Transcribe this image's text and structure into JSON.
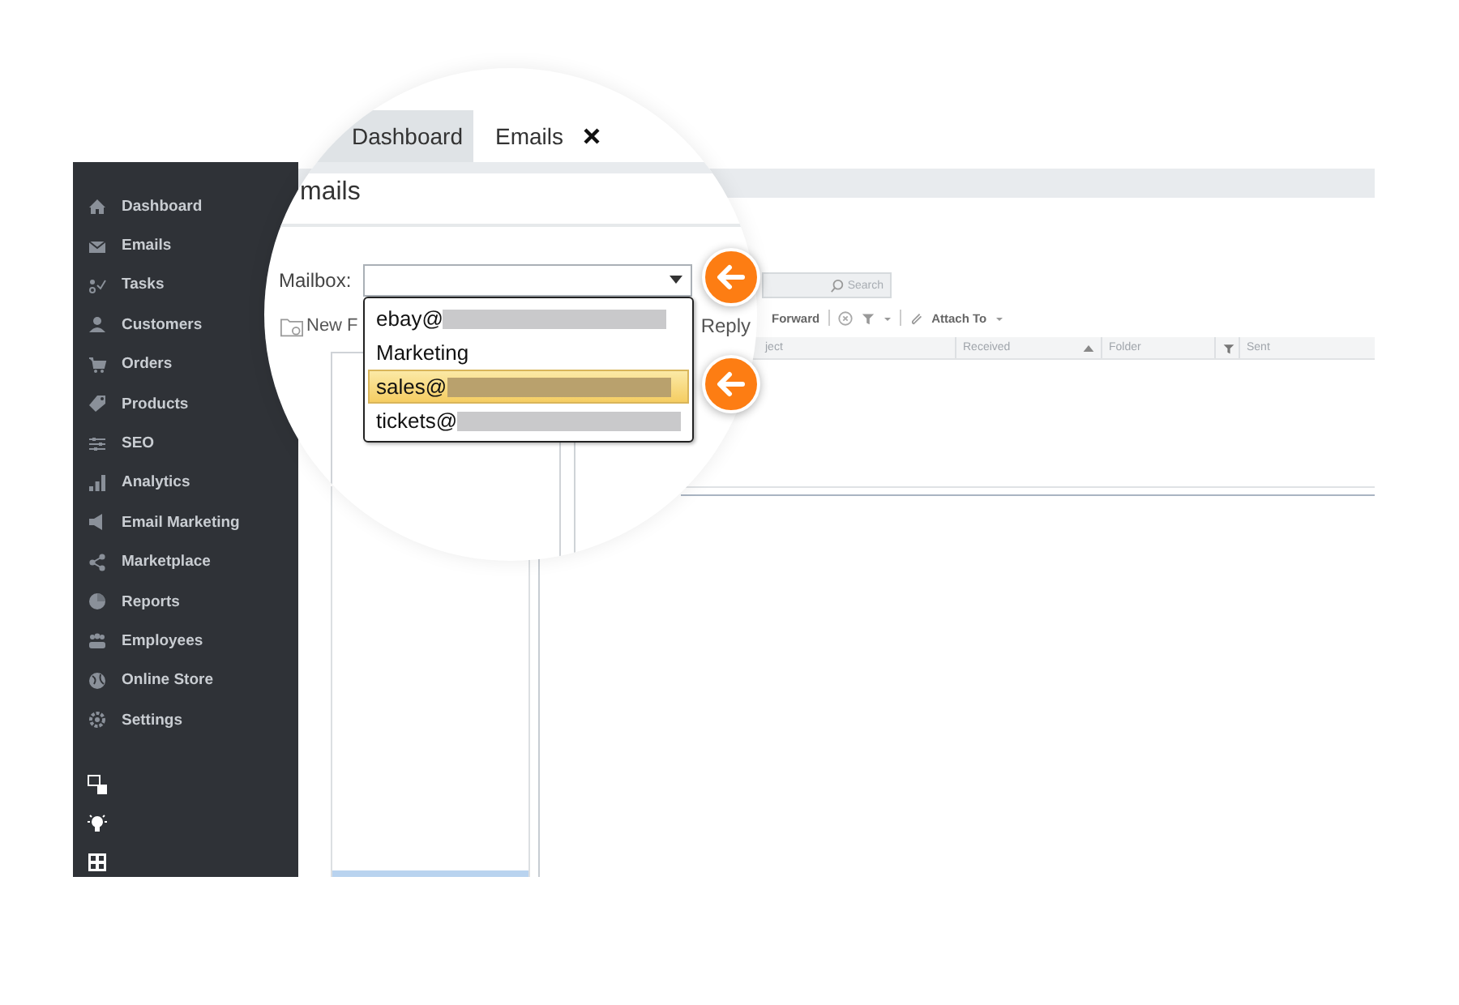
{
  "sidebar": {
    "items": [
      {
        "label": "Dashboard"
      },
      {
        "label": "Emails"
      },
      {
        "label": "Tasks"
      },
      {
        "label": "Customers"
      },
      {
        "label": "Orders"
      },
      {
        "label": "Products"
      },
      {
        "label": "SEO"
      },
      {
        "label": "Analytics"
      },
      {
        "label": "Email Marketing"
      },
      {
        "label": "Marketplace"
      },
      {
        "label": "Reports"
      },
      {
        "label": "Employees"
      },
      {
        "label": "Online Store"
      },
      {
        "label": "Settings"
      }
    ]
  },
  "tabs": [
    {
      "label": "Dashboard",
      "selected": false,
      "closable": false
    },
    {
      "label": "Emails",
      "selected": true,
      "closable": true
    }
  ],
  "page_title": "mails",
  "mailbox": {
    "label": "Mailbox:"
  },
  "mailbox_dropdown": {
    "items": [
      {
        "label": "ebay@",
        "redacted": true,
        "selected": false
      },
      {
        "label": "Marketing",
        "redacted": false,
        "selected": false
      },
      {
        "label": "sales@",
        "redacted": true,
        "selected": true
      },
      {
        "label": "tickets@",
        "redacted": true,
        "selected": false
      }
    ]
  },
  "toolbar": {
    "new_folder": "New F",
    "reply": "Reply",
    "forward": "Forward",
    "attach_to": "Attach To"
  },
  "search": {
    "placeholder": "Search"
  },
  "table": {
    "columns": [
      "ject",
      "Received",
      "Folder",
      "Sent"
    ]
  }
}
